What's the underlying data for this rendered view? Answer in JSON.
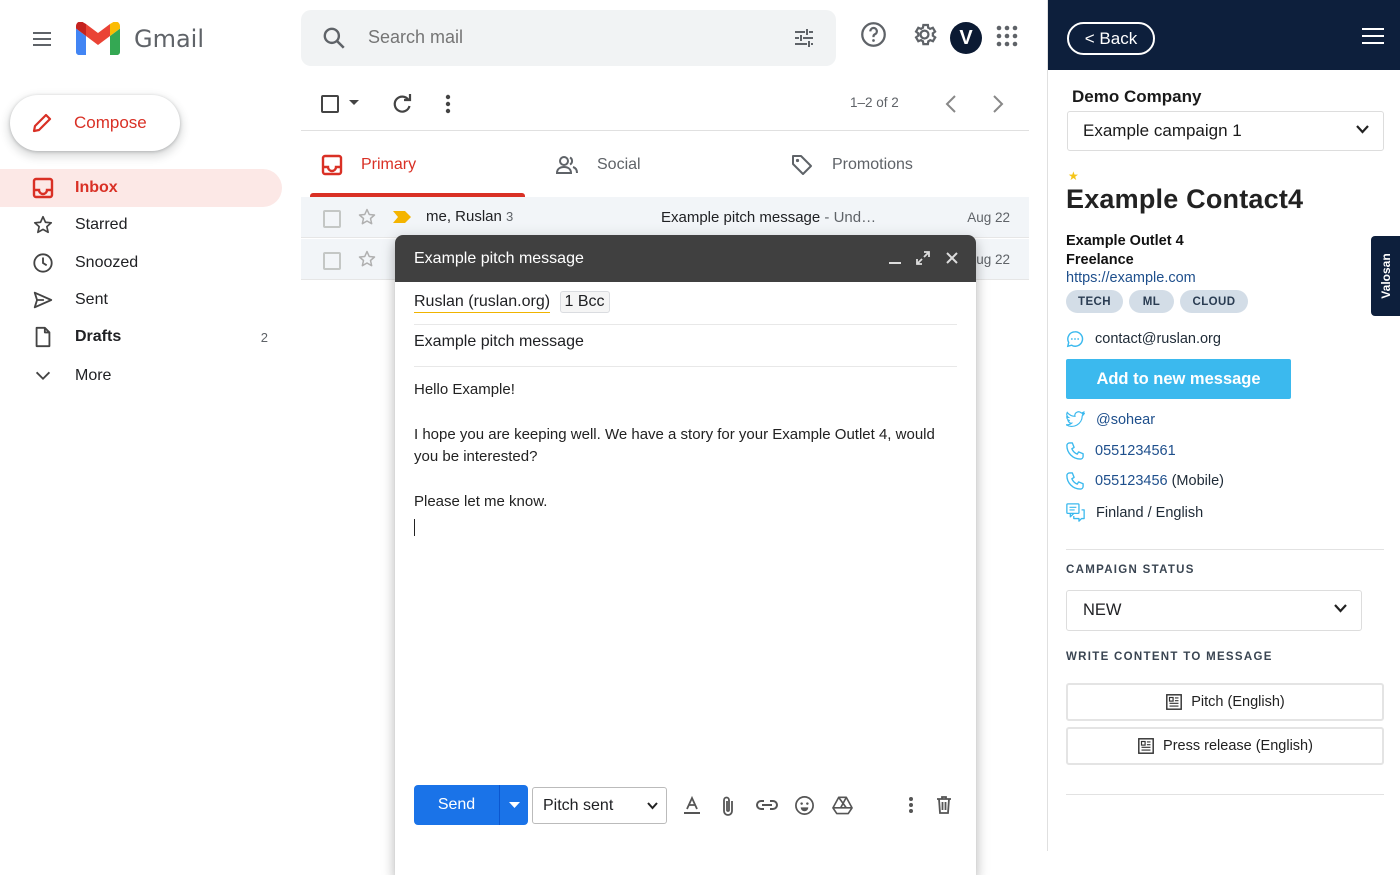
{
  "app": {
    "name": "Gmail"
  },
  "search": {
    "placeholder": "Search mail"
  },
  "compose_button": {
    "label": "Compose"
  },
  "nav": [
    {
      "label": "Inbox",
      "icon": "inbox-icon",
      "active": true
    },
    {
      "label": "Starred",
      "icon": "star-icon"
    },
    {
      "label": "Snoozed",
      "icon": "clock-icon"
    },
    {
      "label": "Sent",
      "icon": "send-icon"
    },
    {
      "label": "Drafts",
      "icon": "draft-icon",
      "count": "2"
    },
    {
      "label": "More",
      "icon": "chevron-down-icon"
    }
  ],
  "toolbar": {
    "pagination": "1–2 of 2"
  },
  "avatar": {
    "letter": "V"
  },
  "tabs": [
    {
      "label": "Primary",
      "icon": "inbox-icon",
      "active": true
    },
    {
      "label": "Social",
      "icon": "people-icon"
    },
    {
      "label": "Promotions",
      "icon": "tag-icon"
    }
  ],
  "emails": [
    {
      "from": "me, Ruslan",
      "count": "3",
      "subject": "Example pitch message",
      "snippet": " - Und…",
      "date": "Aug 22"
    },
    {
      "from": "",
      "count": "",
      "subject": "",
      "snippet": "",
      "date": "ug 22"
    }
  ],
  "compose_window": {
    "title": "Example pitch message",
    "to": "Ruslan (ruslan.org)",
    "bcc": "1 Bcc",
    "subject": "Example pitch message",
    "body": [
      "Hello Example!",
      "I hope you are keeping well. We have a story for your Example Outlet 4, would you be interested?",
      "Please let me know."
    ],
    "send_label": "Send",
    "label_select": "Pitch sent"
  },
  "sidebar": {
    "back_label": "< Back",
    "company": "Demo Company",
    "campaign": "Example campaign 1",
    "contact_name": "Example Contact4",
    "outlet": "Example Outlet 4",
    "role": "Freelance",
    "url": "https://example.com",
    "tags": [
      "TECH",
      "ML",
      "CLOUD"
    ],
    "email": "contact@ruslan.org",
    "add_button": "Add to new message",
    "twitter": "@sohear",
    "phone": "0551234561",
    "mobile": "055123456",
    "mobile_suffix": " (Mobile)",
    "language": "Finland / English",
    "campaign_status_title": "CAMPAIGN STATUS",
    "campaign_status": "NEW",
    "write_content_title": "WRITE CONTENT TO MESSAGE",
    "content_buttons": [
      "Pitch (English)",
      "Press release (English)"
    ],
    "side_tab": "Valosan",
    "accent_color": "#3bb9ee",
    "header_color": "#0d1f3c"
  }
}
